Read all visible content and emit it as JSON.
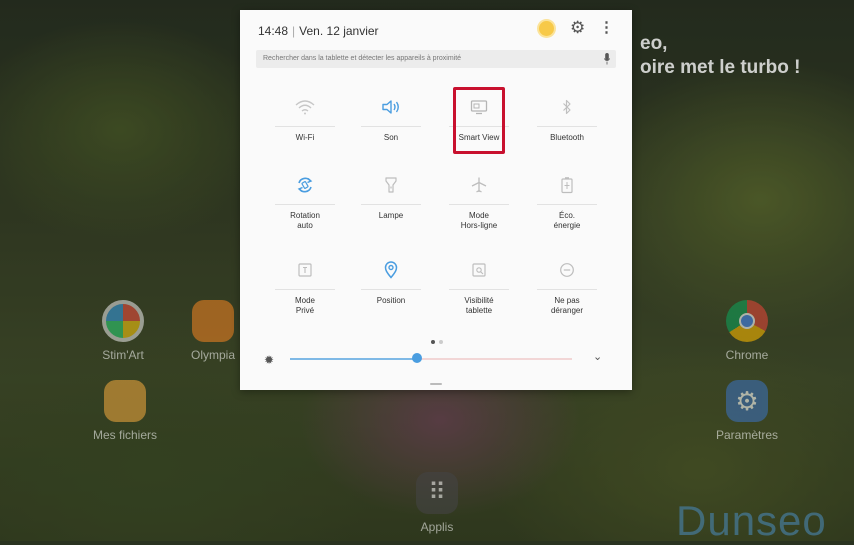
{
  "background": {
    "headline_line1": "eo,",
    "headline_line2": "oire met le turbo !",
    "brand": "Dunseo",
    "apps": [
      {
        "label": "Stim'Art",
        "icon": "stimart-app-icon"
      },
      {
        "label": "Olympia",
        "icon": "olympia-app-icon"
      },
      {
        "label": "Mes fichiers",
        "icon": "folder-icon"
      },
      {
        "label": "Chrome",
        "icon": "chrome-icon"
      },
      {
        "label": "Paramètres",
        "icon": "settings-icon"
      },
      {
        "label": "Applis",
        "icon": "apps-grid-icon"
      }
    ]
  },
  "panel": {
    "time": "14:48",
    "date": "Ven. 12 janvier",
    "search_placeholder": "Rechercher dans la tablette et détecter les appareils à proximité",
    "tiles": [
      {
        "label": "Wi-Fi",
        "icon": "wifi-icon",
        "active": false
      },
      {
        "label": "Son",
        "icon": "volume-icon",
        "active": true
      },
      {
        "label": "Smart View",
        "icon": "smart-view-icon",
        "active": false,
        "highlighted": true
      },
      {
        "label": "Bluetooth",
        "icon": "bluetooth-icon",
        "active": false
      },
      {
        "label": "Rotation\nauto",
        "icon": "rotation-icon",
        "active": true
      },
      {
        "label": "Lampe",
        "icon": "flashlight-icon",
        "active": false
      },
      {
        "label": "Mode\nHors-ligne",
        "icon": "airplane-icon",
        "active": false
      },
      {
        "label": "Éco.\nénergie",
        "icon": "battery-saver-icon",
        "active": false
      },
      {
        "label": "Mode\nPrivé",
        "icon": "private-mode-icon",
        "active": false
      },
      {
        "label": "Position",
        "icon": "location-icon",
        "active": true
      },
      {
        "label": "Visibilité\ntablette",
        "icon": "visibility-icon",
        "active": false
      },
      {
        "label": "Ne pas\ndéranger",
        "icon": "do-not-disturb-icon",
        "active": false
      }
    ],
    "page_count": 2,
    "current_page": 1,
    "brightness_level": 0.45,
    "colors": {
      "accent": "#4a9de0",
      "inactive_icon": "#b5b5b5",
      "highlight": "#c8102e"
    }
  }
}
